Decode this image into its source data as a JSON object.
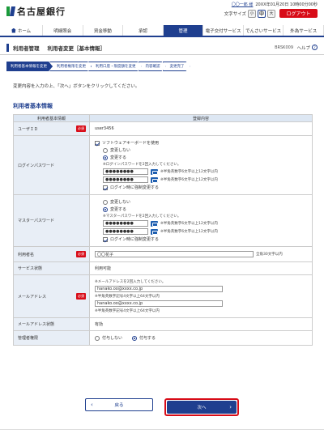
{
  "header": {
    "bank_name": "名古屋銀行",
    "user_name": "〇〇一郎 様",
    "last_login": "20XX年01月20日 10時00分00秒",
    "font_size_label": "文字サイズ",
    "font_size_small": "小",
    "font_size_medium": "中",
    "font_size_large": "大",
    "logout_label": "ログアウト"
  },
  "nav": {
    "home": "ホーム",
    "items": [
      "明細照会",
      "資金移動",
      "承認",
      "管理",
      "電子交付サービス",
      "でんさいサービス",
      "外為サービス"
    ],
    "active_index": 3
  },
  "title_bar": {
    "section": "利用者管理",
    "page": "利用者変更［基本情報］",
    "screen_code": "BRSK009",
    "help_label": "ヘルプ",
    "help_icon_text": "?"
  },
  "steps": [
    "利用者基本情報を変更",
    "利用者権限を変更",
    "利用口座・限度額を変更",
    "内容確認",
    "変更完了"
  ],
  "instruction": "変更内容を入力の上、「次へ」ボタンをクリックしてください。",
  "section_title": "利用者基本情報",
  "table": {
    "col_key": "利用者基本情報",
    "col_val": "登録内容",
    "required_label": "必須",
    "user_id_label": "ユーザＩＤ",
    "user_id_value": "user3456",
    "software_keyboard_label": "ソフトウェアキーボードを使用",
    "login_pw_label": "ログインパスワード",
    "master_pw_label": "マスターパスワード",
    "no_change_label": "変更しない",
    "change_label": "変更する",
    "login_pw_note": "※ログインパスワードを2回入力してください。",
    "master_pw_note": "※マスターパスワードを2回入力してください。",
    "pw_value": "●●●●●●●●",
    "pw_rule": "※半角英数字6文字以上12文字以内",
    "force_change_label": "ログイン時に強制変更する",
    "user_name_label": "利用者名",
    "user_name_value": "〇〇花子",
    "user_name_rule": "全角30文字以内",
    "service_status_label": "サービス状態",
    "service_status_value": "利用可能",
    "email_label": "メールアドレス",
    "email_note": "※メールアドレスを2回入力してください。",
    "email_value": "hanako.oo@xxxx.co.jp",
    "email_rule": "※半角英数字記号4文字以上64文字以内",
    "email_status_label": "メールアドレス状態",
    "email_status_value": "有効",
    "admin_label": "管理者権限",
    "admin_off": "付与しない",
    "admin_on": "付与する"
  },
  "buttons": {
    "back": "戻る",
    "next": "次へ",
    "back_chevron": "‹",
    "next_chevron": "›"
  }
}
